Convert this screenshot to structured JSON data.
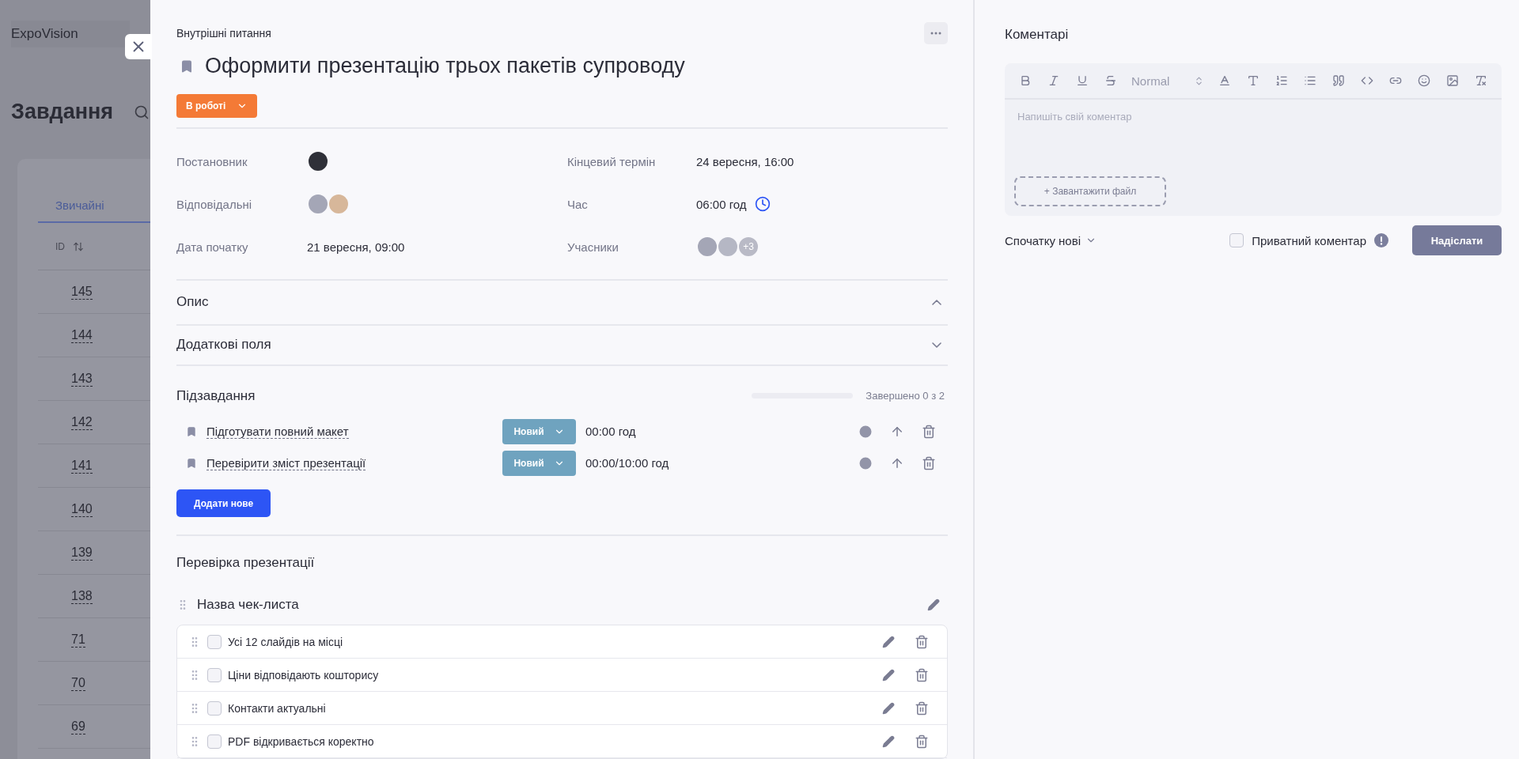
{
  "background": {
    "brand": "ExpoVision",
    "title": "Завдання",
    "tab": "Звичайні",
    "id_header": "ID",
    "ids": [
      "145",
      "144",
      "143",
      "142",
      "141",
      "140",
      "139",
      "138",
      "71",
      "70",
      "69"
    ]
  },
  "task": {
    "category": "Внутрішні питання",
    "title": "Оформити презентацію трьох пакетів супроводу",
    "status": "В роботі",
    "fields": [
      {
        "label": "Постановник",
        "kind": "single"
      },
      {
        "label": "Кінцевий термін",
        "kind": "text",
        "value": "24 вересня, 16:00"
      },
      {
        "label": "Відповідальні",
        "kind": "pair"
      },
      {
        "label": "Час",
        "kind": "time",
        "value": "06:00 год"
      },
      {
        "label": "Дата початку",
        "kind": "text",
        "value": "21 вересня, 09:00"
      },
      {
        "label": "Учасники",
        "kind": "group",
        "more": "+3"
      }
    ],
    "sections": [
      {
        "title": "Опис",
        "expanded": true
      },
      {
        "title": "Додаткові поля",
        "expanded": false
      }
    ],
    "subtasks": {
      "title": "Підзавдання",
      "level": 0,
      "progress_label": "Завершено 0 з 2",
      "add_button": "Додати нове",
      "items": [
        {
          "title": "Підготувати повний макет",
          "status": "Новий",
          "time": "00:00 год"
        },
        {
          "title": "Перевірити зміст презентації",
          "status": "Новий",
          "time": "00:00/10:00 год"
        }
      ]
    },
    "checklist": {
      "section_title": "Перевірка презентації",
      "name": "Назва чек-листа",
      "items": [
        {
          "text": "Усі 12 слайдів на місці",
          "checked": false
        },
        {
          "text": "Ціни відповідають кошторису",
          "checked": false
        },
        {
          "text": "Контакти актуальні",
          "checked": false
        },
        {
          "text": "PDF відкривається коректно",
          "checked": false
        }
      ]
    }
  },
  "comments": {
    "title": "Коментарі",
    "style_select": "Normal",
    "placeholder": "Напишіть свій коментар",
    "upload": "+ Завантажити файл",
    "sort": "Спочатку нові",
    "private_label": "Приватний коментар",
    "private_checked": false,
    "send": "Надіслати"
  }
}
